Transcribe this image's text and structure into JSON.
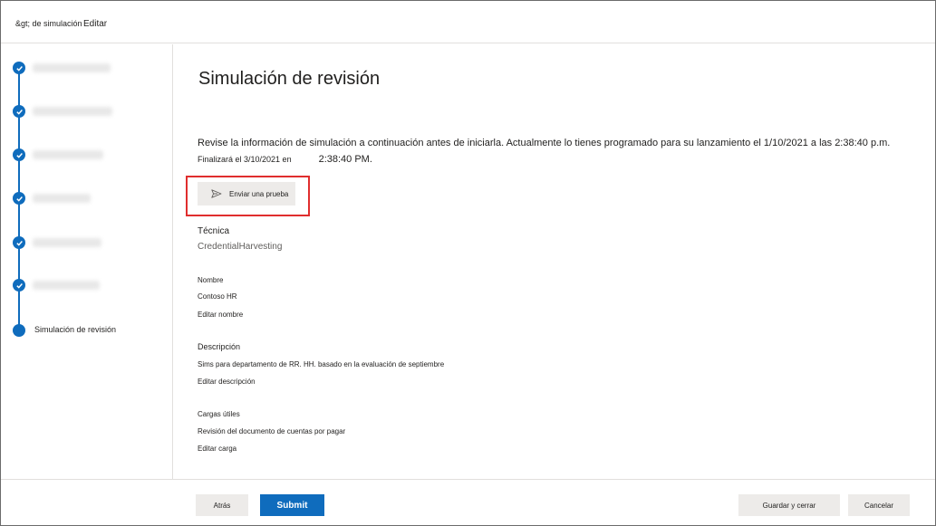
{
  "breadcrumb": {
    "first": "&gt; de simulación",
    "second": "Editar"
  },
  "stepper": {
    "steps": [
      {
        "label": "",
        "state": "completed"
      },
      {
        "label": "",
        "state": "completed"
      },
      {
        "label": "",
        "state": "completed"
      },
      {
        "label": "",
        "state": "completed"
      },
      {
        "label": "",
        "state": "completed"
      },
      {
        "label": "",
        "state": "completed"
      },
      {
        "label": "Simulación de revisión",
        "state": "current"
      }
    ]
  },
  "main": {
    "title": "Simulación de revisión",
    "description_line1": "Revise la información de simulación a continuación antes de iniciarla. Actualmente lo tienes programado para su lanzamiento el 1/10/2021 a las 2:38:40 p.m.",
    "description_line2a": "Finalizará el 3/10/2021 en",
    "description_line2b": "2:38:40 PM.",
    "send_test_label": "Enviar una prueba",
    "technique": {
      "label": "Técnica",
      "value": "CredentialHarvesting"
    },
    "name": {
      "label": "Nombre",
      "value": "Contoso HR",
      "edit": "Editar nombre"
    },
    "description": {
      "label": "Descripción",
      "value": "Sims para departamento de RR. HH. basado en la evaluación de septiembre",
      "edit": "Editar descripción"
    },
    "payloads": {
      "label": "Cargas útiles",
      "value": "Revisión del documento de cuentas por pagar",
      "edit": "Editar carga"
    }
  },
  "footer": {
    "back": "Atrás",
    "submit": "Submit",
    "save_close": "Guardar y cerrar",
    "cancel": "Cancelar"
  },
  "colors": {
    "accent": "#0f6cbd",
    "highlight": "#e02e2e",
    "button_gray": "#edebe9"
  }
}
